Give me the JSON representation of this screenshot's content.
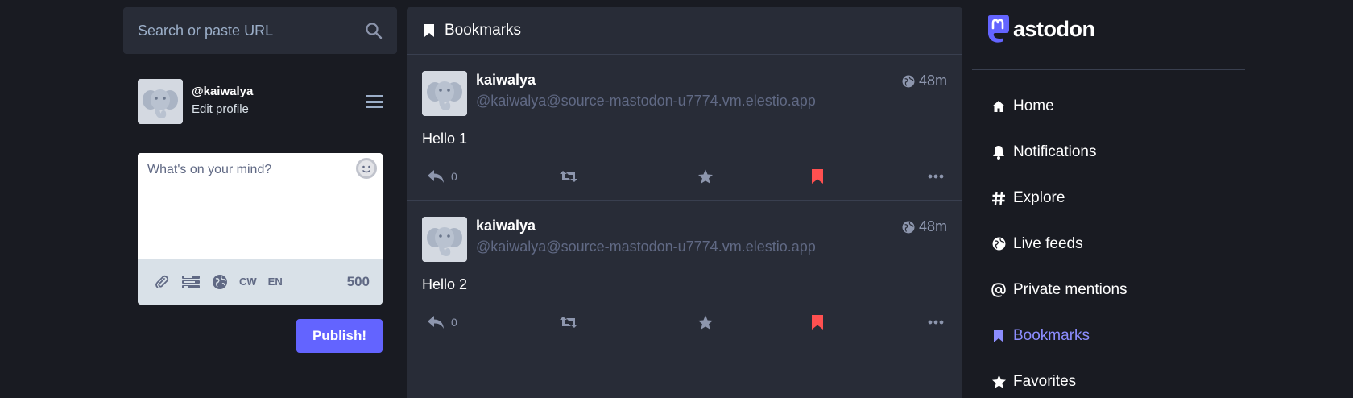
{
  "search": {
    "placeholder": "Search or paste URL"
  },
  "account": {
    "handle": "@kaiwalya",
    "edit_label": "Edit profile"
  },
  "composer": {
    "placeholder": "What's on your mind?",
    "cw_label": "CW",
    "lang_label": "EN",
    "char_count": "500",
    "publish_label": "Publish!"
  },
  "column": {
    "title": "Bookmarks",
    "statuses": [
      {
        "display_name": "kaiwalya",
        "acct": "@kaiwalya@source-mastodon-u7774.vm.elestio.app",
        "time": "48m",
        "content": "Hello 1",
        "reply_count": "0",
        "bookmarked": true
      },
      {
        "display_name": "kaiwalya",
        "acct": "@kaiwalya@source-mastodon-u7774.vm.elestio.app",
        "time": "48m",
        "content": "Hello 2",
        "reply_count": "0",
        "bookmarked": true
      }
    ]
  },
  "brand": {
    "wordmark": "astodon"
  },
  "nav": {
    "items": [
      {
        "label": "Home",
        "icon": "home-icon"
      },
      {
        "label": "Notifications",
        "icon": "bell-icon"
      },
      {
        "label": "Explore",
        "icon": "hashtag-icon"
      },
      {
        "label": "Live feeds",
        "icon": "globe-icon"
      },
      {
        "label": "Private mentions",
        "icon": "at-icon"
      },
      {
        "label": "Bookmarks",
        "icon": "bookmark-icon",
        "active": true
      },
      {
        "label": "Favorites",
        "icon": "star-icon"
      }
    ]
  },
  "colors": {
    "background": "#191b22",
    "panel": "#282c37",
    "accent": "#6364ff",
    "active_nav": "#8c8dff",
    "bookmark_active": "#ff5050",
    "muted": "#606984"
  }
}
